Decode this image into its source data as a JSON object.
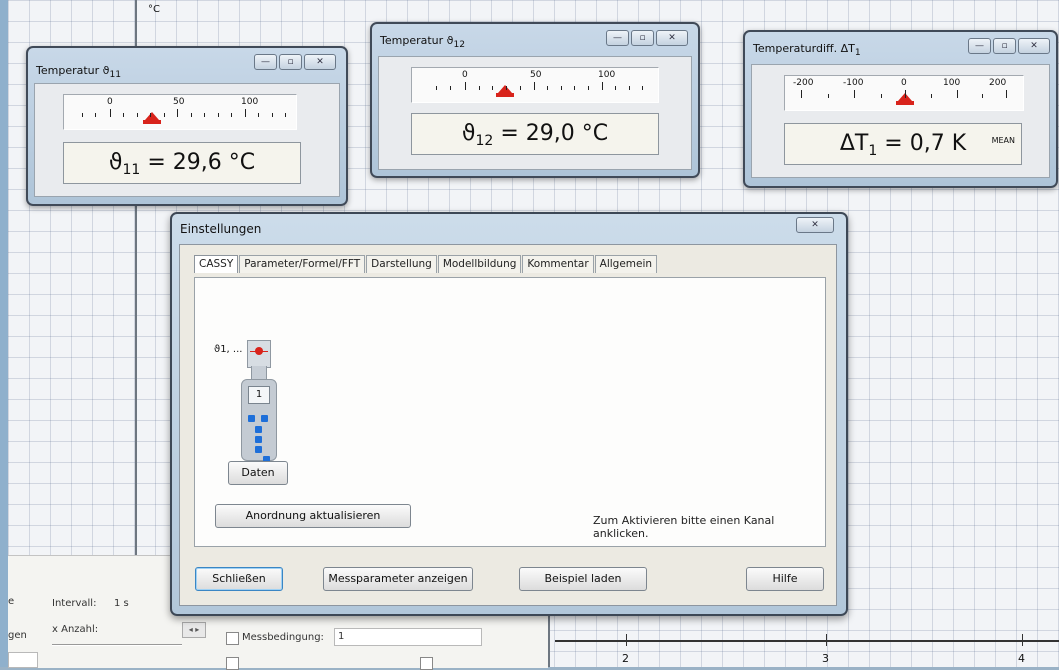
{
  "background": {
    "unit_label": "°C",
    "axis_numbers": [
      "2",
      "3",
      "4"
    ]
  },
  "bottom_panel": {
    "left_clip_1": "e",
    "left_clip_2": "gen",
    "interval_label": "Intervall:",
    "interval_value": "1 s",
    "count_label": "x Anzahl:",
    "condition_label": "Messbedingung:",
    "condition_value": "1",
    "spinner": "◂ ▸"
  },
  "meters": [
    {
      "title": "Temperatur ϑ",
      "title_sub": "11",
      "scale_labels": [
        "0",
        "50",
        "100"
      ],
      "value_symbol": "ϑ",
      "value_sub": "11",
      "value_text": "=  29,6 °C",
      "value": 29.6,
      "mean": ""
    },
    {
      "title": "Temperatur ϑ",
      "title_sub": "12",
      "scale_labels": [
        "0",
        "50",
        "100"
      ],
      "value_symbol": "ϑ",
      "value_sub": "12",
      "value_text": "=  29,0 °C",
      "value": 29.0,
      "mean": ""
    },
    {
      "title": "Temperaturdiff. ΔT",
      "title_sub": "1",
      "scale_labels": [
        "-200",
        "-100",
        "0",
        "100",
        "200"
      ],
      "value_symbol": "ΔT",
      "value_sub": "1",
      "value_text": "=  0,7 K",
      "value": 0.7,
      "mean": "MEAN"
    }
  ],
  "window_buttons": {
    "minimize": "—",
    "maximize": "▫",
    "close": "✕"
  },
  "dialog": {
    "title": "Einstellungen",
    "close": "✕",
    "tabs": [
      "CASSY",
      "Parameter/Formel/FFT",
      "Darstellung",
      "Modellbildung",
      "Kommentar",
      "Allgemein"
    ],
    "active_tab": 0,
    "device_label": "ϑ1, ...",
    "device_screen": "1",
    "data_button": "Daten",
    "update_button": "Anordnung aktualisieren",
    "hint": "Zum Aktivieren bitte einen Kanal anklicken.",
    "close_button": "Schließen",
    "params_button": "Messparameter anzeigen",
    "example_button": "Beispiel laden",
    "help_button": "Hilfe"
  },
  "colors": {
    "marker": "#d8231b",
    "device_dots": "#1e6fd9",
    "window_frame": "#404a58"
  }
}
